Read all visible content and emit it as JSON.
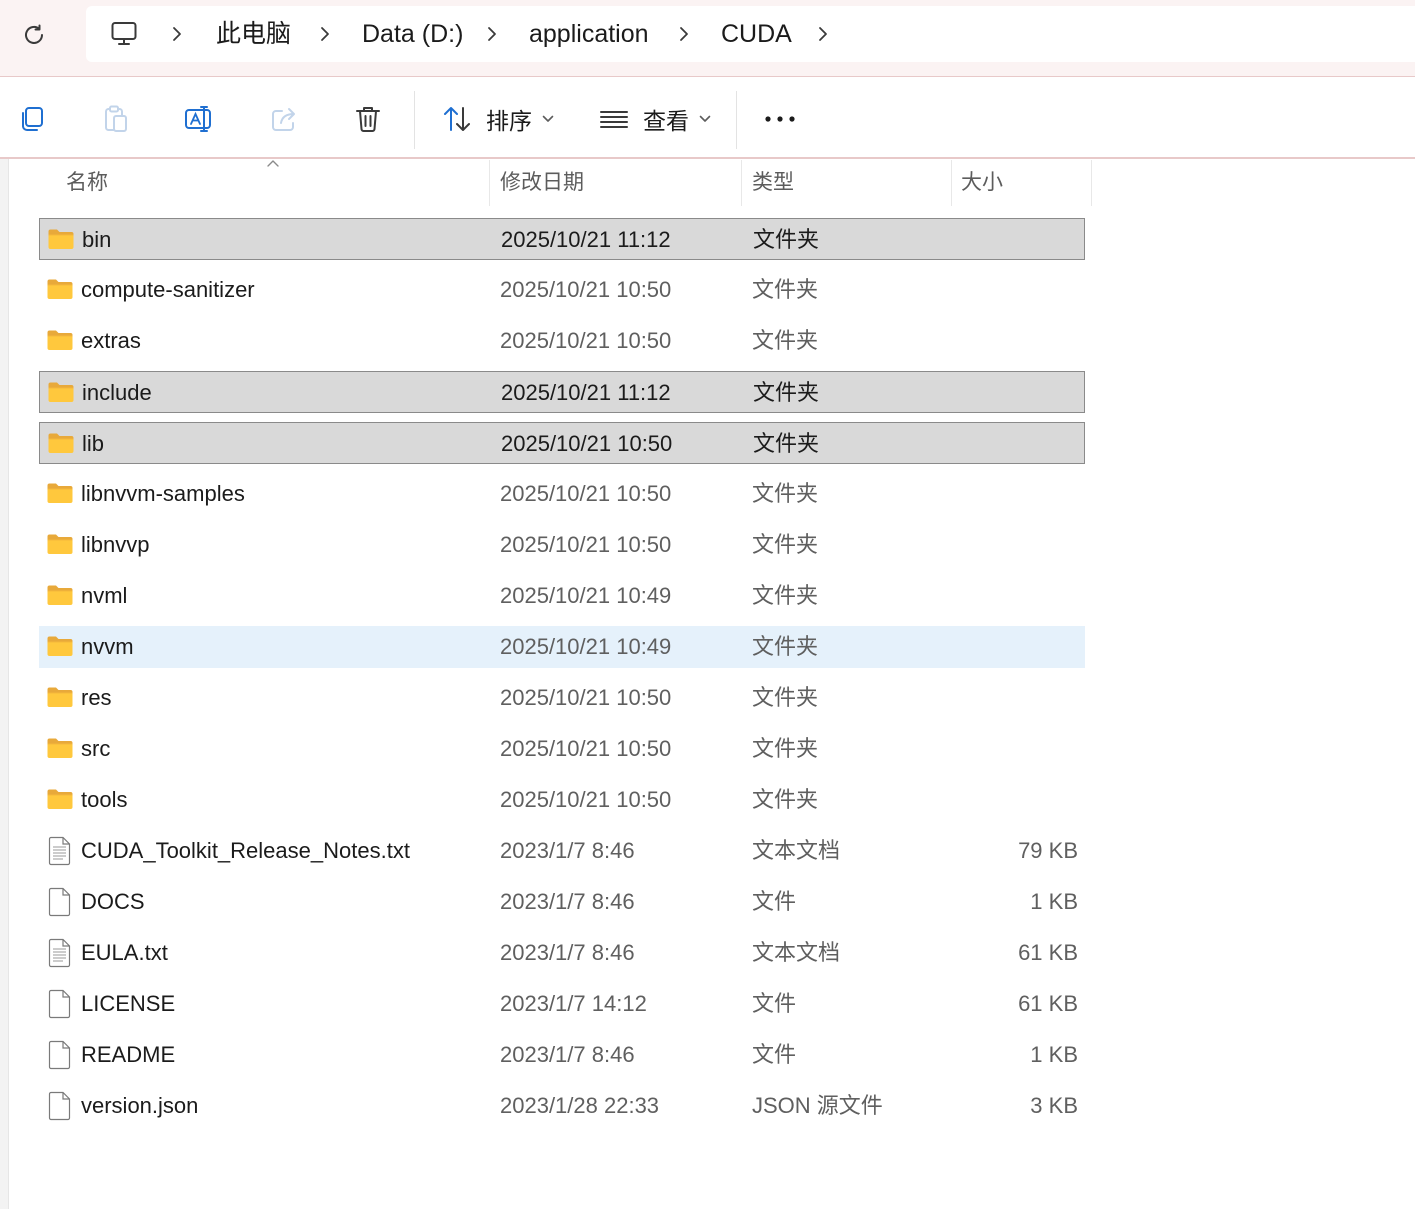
{
  "breadcrumb": {
    "items": [
      "此电脑",
      "Data (D:)",
      "application",
      "CUDA"
    ]
  },
  "toolbar": {
    "sort_label": "排序",
    "view_label": "查看"
  },
  "columns": {
    "name": "名称",
    "modified": "修改日期",
    "type": "类型",
    "size": "大小"
  },
  "files": [
    {
      "name": "bin",
      "modified": "2025/10/21 11:12",
      "type": "文件夹",
      "size": "",
      "icon": "folder-icon",
      "state": "selected"
    },
    {
      "name": "compute-sanitizer",
      "modified": "2025/10/21 10:50",
      "type": "文件夹",
      "size": "",
      "icon": "folder-icon",
      "state": "normal"
    },
    {
      "name": "extras",
      "modified": "2025/10/21 10:50",
      "type": "文件夹",
      "size": "",
      "icon": "folder-icon",
      "state": "normal"
    },
    {
      "name": "include",
      "modified": "2025/10/21 11:12",
      "type": "文件夹",
      "size": "",
      "icon": "folder-icon",
      "state": "selected"
    },
    {
      "name": "lib",
      "modified": "2025/10/21 10:50",
      "type": "文件夹",
      "size": "",
      "icon": "folder-icon",
      "state": "selected"
    },
    {
      "name": "libnvvm-samples",
      "modified": "2025/10/21 10:50",
      "type": "文件夹",
      "size": "",
      "icon": "folder-icon",
      "state": "normal"
    },
    {
      "name": "libnvvp",
      "modified": "2025/10/21 10:50",
      "type": "文件夹",
      "size": "",
      "icon": "folder-icon",
      "state": "normal"
    },
    {
      "name": "nvml",
      "modified": "2025/10/21 10:49",
      "type": "文件夹",
      "size": "",
      "icon": "folder-icon",
      "state": "normal"
    },
    {
      "name": "nvvm",
      "modified": "2025/10/21 10:49",
      "type": "文件夹",
      "size": "",
      "icon": "folder-icon",
      "state": "hovered"
    },
    {
      "name": "res",
      "modified": "2025/10/21 10:50",
      "type": "文件夹",
      "size": "",
      "icon": "folder-icon",
      "state": "normal"
    },
    {
      "name": "src",
      "modified": "2025/10/21 10:50",
      "type": "文件夹",
      "size": "",
      "icon": "folder-icon",
      "state": "normal"
    },
    {
      "name": "tools",
      "modified": "2025/10/21 10:50",
      "type": "文件夹",
      "size": "",
      "icon": "folder-icon",
      "state": "normal"
    },
    {
      "name": "CUDA_Toolkit_Release_Notes.txt",
      "modified": "2023/1/7 8:46",
      "type": "文本文档",
      "size": "79 KB",
      "icon": "text-file-icon",
      "state": "normal"
    },
    {
      "name": "DOCS",
      "modified": "2023/1/7 8:46",
      "type": "文件",
      "size": "1 KB",
      "icon": "blank-file-icon",
      "state": "normal"
    },
    {
      "name": "EULA.txt",
      "modified": "2023/1/7 8:46",
      "type": "文本文档",
      "size": "61 KB",
      "icon": "text-file-icon",
      "state": "normal"
    },
    {
      "name": "LICENSE",
      "modified": "2023/1/7 14:12",
      "type": "文件",
      "size": "61 KB",
      "icon": "blank-file-icon",
      "state": "normal"
    },
    {
      "name": "README",
      "modified": "2023/1/7 8:46",
      "type": "文件",
      "size": "1 KB",
      "icon": "blank-file-icon",
      "state": "normal"
    },
    {
      "name": "version.json",
      "modified": "2023/1/28 22:33",
      "type": "JSON 源文件",
      "size": "3 KB",
      "icon": "blank-file-icon",
      "state": "normal"
    }
  ],
  "colors": {
    "selected_bg": "#d9d9d9",
    "hover_bg": "#e5f1fb",
    "folder": "#ffc83d"
  }
}
